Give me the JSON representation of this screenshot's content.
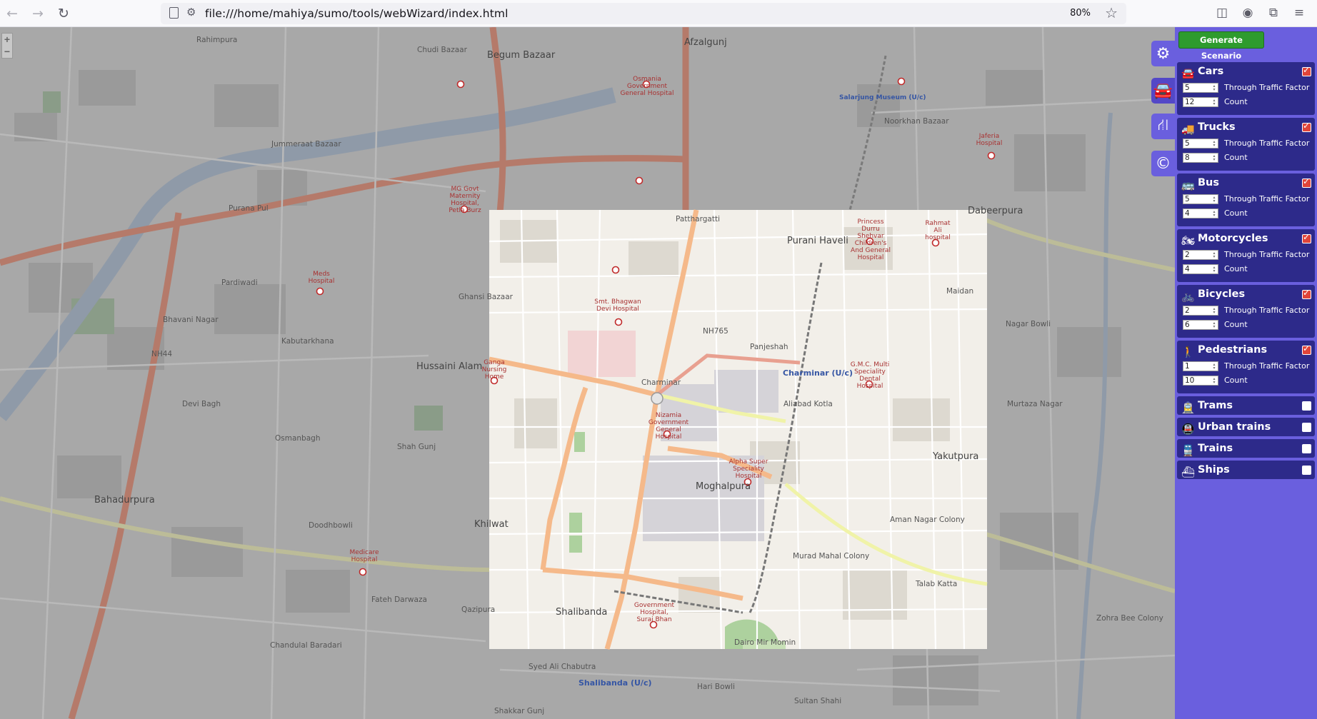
{
  "browser": {
    "url": "file:///home/mahiya/sumo/tools/webWizard/index.html",
    "zoom": "80%",
    "back_icon": "back-arrow-icon",
    "forward_icon": "forward-arrow-icon",
    "reload_icon": "reload-icon"
  },
  "map": {
    "zoom_in": "+",
    "zoom_out": "−",
    "labels": {
      "begum_bazaar": "Begum Bazaar",
      "afzalgunj": "Afzalgunj",
      "rahimpura": "Rahimpura",
      "chudi_bazaar": "Chudi Bazaar",
      "jummeraat_bazaar": "Jummeraat Bazaar",
      "purana_pul": "Purana Pul",
      "pardiwadi": "Pardiwadi",
      "bhavani_nagar": "Bhavani Nagar",
      "kabutarkhana": "Kabutarkhana",
      "hussaini_alam": "Hussaini Alam",
      "ghansi_bazaar": "Ghansi Bazaar",
      "devi_bagh": "Devi Bagh",
      "osmanbagh": "Osmanbagh",
      "shah_gunj": "Shah Gunj",
      "bahadurpura": "Bahadurpura",
      "doodhbowli": "Doodhbowli",
      "khilwat": "Khilwat",
      "fateh_darwaza": "Fateh Darwaza",
      "qazipura": "Qazipura",
      "chandulal_baradari": "Chandulal Baradari",
      "syed_ali_chabutra": "Syed Ali Chabutra",
      "shalibanda": "Shalibanda",
      "moghalpura": "Moghalpura",
      "purani_haveli": "Purani Haveli",
      "charminar": "Charminar",
      "panjeshah": "Panjeshah",
      "aliabad_kotla": "Aliabad Kotla",
      "yakutpura": "Yakutpura",
      "dabeerpura": "Dabeerpura",
      "noorkhan_bazaar": "Noorkhan Bazaar",
      "murad_mahal_colony": "Murad Mahal Colony",
      "aman_nagar_colony": "Aman Nagar Colony",
      "talab_katta": "Talab Katta",
      "patthargatti": "Patthargatti",
      "maidan": "Maidan",
      "nagar_bowli": "Nagar Bowli",
      "murtaza_nagar": "Murtaza Nagar",
      "zohra_bee_colony": "Zohra Bee Colony",
      "sultan_shahi": "Sultan Shahi",
      "hari_bowli": "Hari Bowli",
      "shakkar_gunj": "Shakkar Gunj",
      "dairo_mir_momin": "Dairo Mir Momin",
      "nh44": "NH44",
      "nh765": "NH765",
      "charminar_station": "Charminar (U/c)",
      "shalibanda_station": "Shalibanda (U/c)",
      "salarjung_museum": "Salarjung Museum (U/c)",
      "hospitals": {
        "osmania": "Osmania Government General Hospital",
        "mg_govt": "MG Govt Maternity Hospital, Petla Burz",
        "meds": "Meds Hospital",
        "bhagwan_devi": "Smt. Bhagwan Devi Hospital",
        "ganga": "Ganga Nursing Home",
        "nizamia": "Nizamia Government General Hospital",
        "alpha": "Alpha Super Speciality Hospital",
        "durru": "Princess Durru Shehvar Children's And General Hospital",
        "gmc": "G.M.C. Multi Speciality Dental Hospital",
        "rahmat": "Rahmat Ali hospital",
        "govt_suraj": "Government Hospital, Suraj Bhan",
        "medicare": "Medicare Hospital",
        "jaferia": "Jaferia Hospital"
      }
    }
  },
  "panel": {
    "generate_label": "Generate Scenario",
    "side_tabs": [
      "gear-icon",
      "car-icon",
      "road-icon",
      "copyright-icon"
    ],
    "vehicles": [
      {
        "name": "Cars",
        "icon": "car-icon",
        "checked": true,
        "factor": "5",
        "count": "12",
        "factor_label": "Through Traffic Factor",
        "count_label": "Count"
      },
      {
        "name": "Trucks",
        "icon": "truck-icon",
        "checked": true,
        "factor": "5",
        "count": "8",
        "factor_label": "Through Traffic Factor",
        "count_label": "Count"
      },
      {
        "name": "Bus",
        "icon": "bus-icon",
        "checked": true,
        "factor": "5",
        "count": "4",
        "factor_label": "Through Traffic Factor",
        "count_label": "Count"
      },
      {
        "name": "Motorcycles",
        "icon": "motorcycle-icon",
        "checked": true,
        "factor": "2",
        "count": "4",
        "factor_label": "Through Traffic Factor",
        "count_label": "Count"
      },
      {
        "name": "Bicycles",
        "icon": "bicycle-icon",
        "checked": true,
        "factor": "2",
        "count": "6",
        "factor_label": "Through Traffic Factor",
        "count_label": "Count"
      },
      {
        "name": "Pedestrians",
        "icon": "pedestrian-icon",
        "checked": true,
        "factor": "1",
        "count": "10",
        "factor_label": "Through Traffic Factor",
        "count_label": "Count"
      },
      {
        "name": "Trams",
        "icon": "tram-icon",
        "checked": false
      },
      {
        "name": "Urban trains",
        "icon": "urban-train-icon",
        "checked": false
      },
      {
        "name": "Trains",
        "icon": "train-icon",
        "checked": false
      },
      {
        "name": "Ships",
        "icon": "ship-icon",
        "checked": false
      }
    ]
  }
}
